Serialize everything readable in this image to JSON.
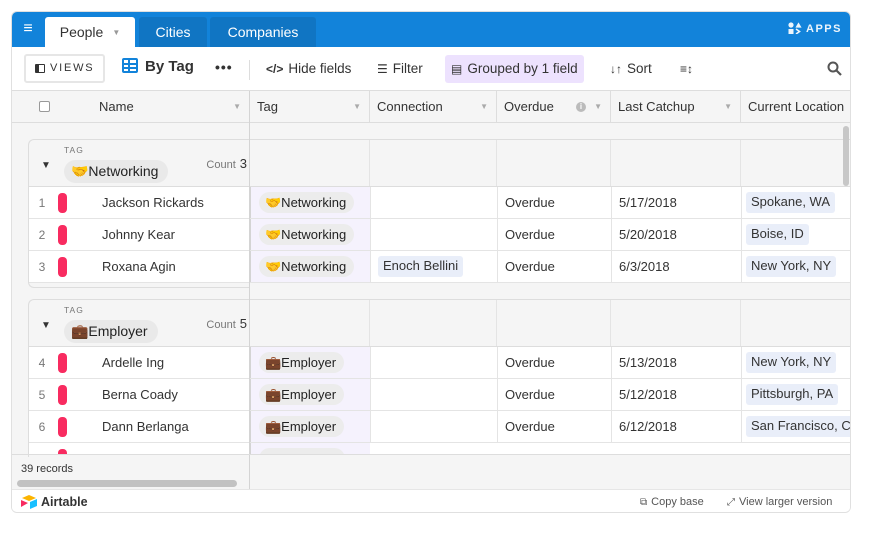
{
  "topbar": {
    "tabs": [
      {
        "label": "People",
        "active": true
      },
      {
        "label": "Cities",
        "active": false
      },
      {
        "label": "Companies",
        "active": false
      }
    ],
    "apps_label": "APPS"
  },
  "toolbar": {
    "views_label": "VIEWS",
    "view_name": "By Tag",
    "more_label": "•••",
    "hide_fields_label": "Hide fields",
    "filter_label": "Filter",
    "grouped_label": "Grouped by 1 field",
    "sort_label": "Sort",
    "colors": {
      "accent": "#1283da",
      "grouped_bg": "#ede2fe"
    }
  },
  "grid": {
    "columns": [
      "Name",
      "Tag",
      "Connection",
      "Overdue",
      "Last Catchup",
      "Current Location"
    ],
    "groups": [
      {
        "field_label": "TAG",
        "value": "🤝Networking",
        "count_label": "Count",
        "count": "3",
        "rows": [
          {
            "num": "1",
            "name": "Jackson Rickards",
            "tag": "🤝Networking",
            "connection": "",
            "overdue": "Overdue",
            "last_catchup": "5/17/2018",
            "location": "Spokane, WA"
          },
          {
            "num": "2",
            "name": "Johnny Kear",
            "tag": "🤝Networking",
            "connection": "",
            "overdue": "Overdue",
            "last_catchup": "5/20/2018",
            "location": "Boise, ID"
          },
          {
            "num": "3",
            "name": "Roxana Agin",
            "tag": "🤝Networking",
            "connection": "Enoch Bellini",
            "overdue": "Overdue",
            "last_catchup": "6/3/2018",
            "location": "New York, NY"
          }
        ]
      },
      {
        "field_label": "TAG",
        "value": "💼Employer",
        "count_label": "Count",
        "count": "5",
        "rows": [
          {
            "num": "4",
            "name": "Ardelle Ing",
            "tag": "💼Employer",
            "connection": "",
            "overdue": "Overdue",
            "last_catchup": "5/13/2018",
            "location": "New York, NY"
          },
          {
            "num": "5",
            "name": "Berna Coady",
            "tag": "💼Employer",
            "connection": "",
            "overdue": "Overdue",
            "last_catchup": "5/12/2018",
            "location": "Pittsburgh, PA"
          },
          {
            "num": "6",
            "name": "Dann Berlanga",
            "tag": "💼Employer",
            "connection": "",
            "overdue": "Overdue",
            "last_catchup": "6/12/2018",
            "location": "San Francisco, CA"
          }
        ]
      }
    ],
    "record_color": "#f82b60",
    "records_summary": "39 records"
  },
  "bottombar": {
    "brand": "Airtable",
    "copy_base_label": "Copy base",
    "view_larger_label": "View larger version"
  }
}
